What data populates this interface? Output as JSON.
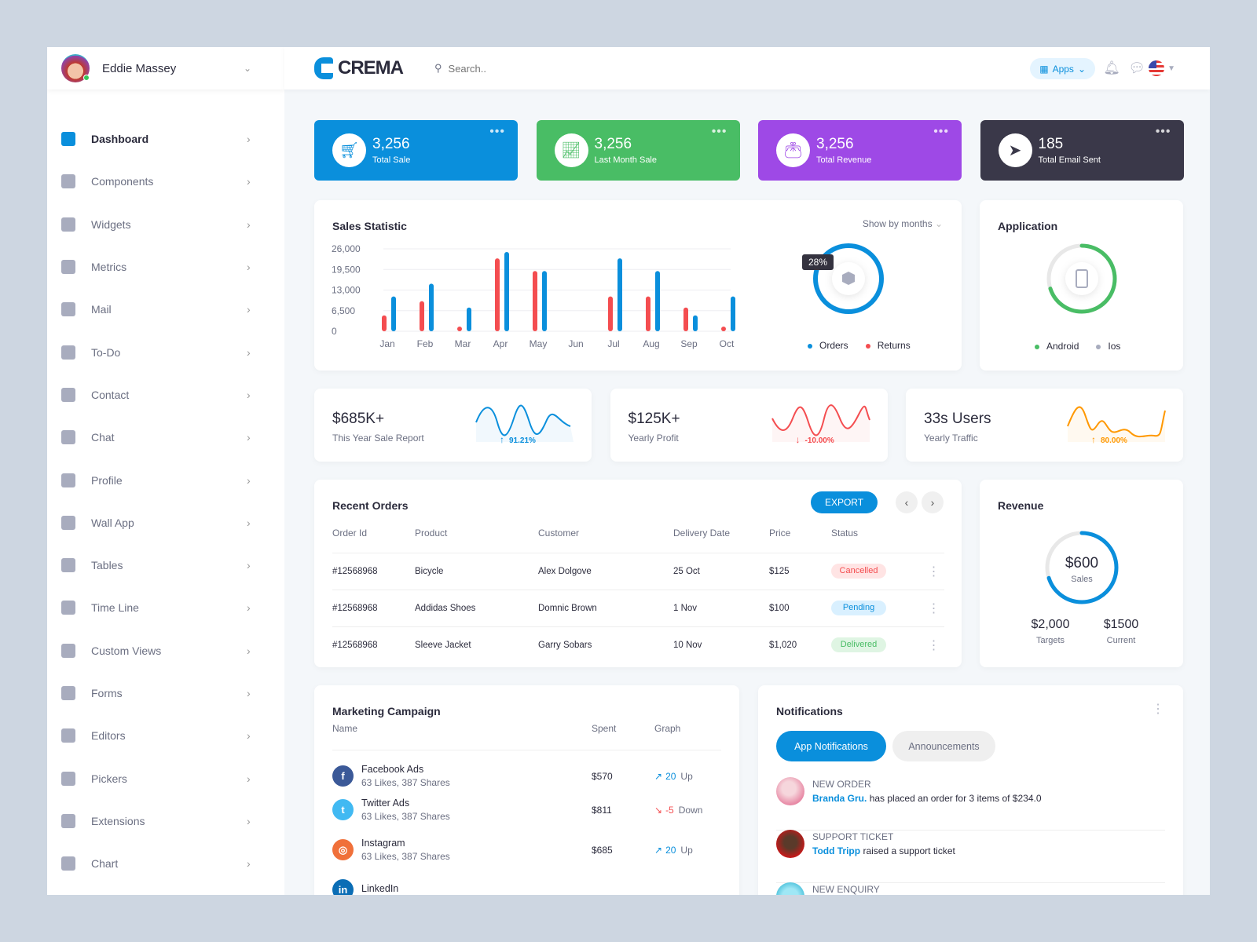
{
  "user": {
    "name": "Eddie Massey"
  },
  "brand": {
    "name": "CREMA"
  },
  "search": {
    "placeholder": "Search.."
  },
  "topbar": {
    "apps_label": "Apps"
  },
  "sidebar": {
    "items": [
      {
        "label": "Dashboard",
        "active": true
      },
      {
        "label": "Components"
      },
      {
        "label": "Widgets"
      },
      {
        "label": "Metrics"
      },
      {
        "label": "Mail"
      },
      {
        "label": "To-Do"
      },
      {
        "label": "Contact"
      },
      {
        "label": "Chat"
      },
      {
        "label": "Profile"
      },
      {
        "label": "Wall App"
      },
      {
        "label": "Tables"
      },
      {
        "label": "Time Line"
      },
      {
        "label": "Custom Views"
      },
      {
        "label": "Forms"
      },
      {
        "label": "Editors"
      },
      {
        "label": "Pickers"
      },
      {
        "label": "Extensions"
      },
      {
        "label": "Chart"
      }
    ]
  },
  "kpis": [
    {
      "value": "3,256",
      "label": "Total Sale",
      "color": "#0a8fdc",
      "icon": "cart-icon"
    },
    {
      "value": "3,256",
      "label": "Last Month Sale",
      "color": "#49bd65",
      "icon": "growth-chart-icon"
    },
    {
      "value": "3,256",
      "label": "Total Revenue",
      "color": "#9e49e6",
      "icon": "wallet-icon"
    },
    {
      "value": "185",
      "label": "Total Email Sent",
      "color": "#3a3849",
      "icon": "paper-plane-icon"
    }
  ],
  "sales": {
    "title": "Sales Statistic",
    "filter": "Show by months",
    "tooltip": "28%",
    "legend": [
      "Orders",
      "Returns"
    ]
  },
  "chart_data": {
    "type": "bar",
    "title": "Sales Statistic",
    "categories": [
      "Jan",
      "Feb",
      "Mar",
      "Apr",
      "May",
      "Jun",
      "Jul",
      "Aug",
      "Sep",
      "Oct"
    ],
    "yticks": [
      "26,000",
      "19,500",
      "13,000",
      "6,500",
      "0"
    ],
    "ylim": [
      0,
      26000
    ],
    "grid": true,
    "series": [
      {
        "name": "Returns",
        "color": "#f44d50",
        "values": [
          5000,
          9500,
          1500,
          23000,
          19000,
          null,
          11000,
          11000,
          7500,
          1500
        ]
      },
      {
        "name": "Orders",
        "color": "#0a8fdc",
        "values": [
          11000,
          15000,
          7500,
          25000,
          19000,
          null,
          23000,
          19000,
          5000,
          11000
        ]
      }
    ],
    "donut": {
      "Orders": 72,
      "Returns": 28
    }
  },
  "application": {
    "title": "Application",
    "android_percent": 70,
    "legend": [
      "Android",
      "Ios"
    ]
  },
  "stats": [
    {
      "value": "$685K+",
      "label": "This Year Sale Report",
      "change": "91.21%",
      "color": "#0a8fdc",
      "trend": "up"
    },
    {
      "value": "$125K+",
      "label": "Yearly Profit",
      "change": "-10.00%",
      "color": "#f44d50",
      "trend": "down"
    },
    {
      "value": "33s Users",
      "label": "Yearly Traffic",
      "change": "80.00%",
      "color": "#ff9800",
      "trend": "up"
    }
  ],
  "orders": {
    "title": "Recent Orders",
    "export": "EXPORT",
    "columns": [
      "Order Id",
      "Product",
      "Customer",
      "Delivery Date",
      "Price",
      "Status"
    ],
    "rows": [
      [
        "#12568968",
        "Bicycle",
        "Alex Dolgove",
        "25 Oct",
        "$125",
        "Cancelled"
      ],
      [
        "#12568968",
        "Addidas Shoes",
        "Domnic Brown",
        "1 Nov",
        "$100",
        "Pending"
      ],
      [
        "#12568968",
        "Sleeve Jacket",
        "Garry Sobars",
        "10 Nov",
        "$1,020",
        "Delivered"
      ]
    ]
  },
  "revenue": {
    "title": "Revenue",
    "value": "$600",
    "value_label": "Sales",
    "progress_percent": 70,
    "targets": "$2,000",
    "targets_label": "Targets",
    "current": "$1500",
    "current_label": "Current"
  },
  "marketing": {
    "title": "Marketing Campaign",
    "columns": [
      "Name",
      "Spent",
      "Graph"
    ],
    "rows": [
      {
        "name": "Facebook Ads",
        "meta": "63 Likes, 387 Shares",
        "spent": "$570",
        "delta": "20",
        "dir": "Up",
        "color": "#3b5998",
        "icon": "facebook-icon",
        "glyph": "f"
      },
      {
        "name": "Twitter Ads",
        "meta": "63 Likes, 387 Shares",
        "spent": "$811",
        "delta": "-5",
        "dir": "Down",
        "color": "#41b9f2",
        "icon": "twitter-icon",
        "glyph": "t"
      },
      {
        "name": "Instagram",
        "meta": "63 Likes, 387 Shares",
        "spent": "$685",
        "delta": "20",
        "dir": "Up",
        "color": "#f0703a",
        "icon": "instagram-icon",
        "glyph": "◎"
      },
      {
        "name": "LinkedIn",
        "meta": "",
        "spent": "",
        "delta": "",
        "dir": "",
        "color": "#0a6db5",
        "icon": "linkedin-icon",
        "glyph": "in"
      }
    ]
  },
  "notifications": {
    "title": "Notifications",
    "tabs": [
      "App Notifications",
      "Announcements"
    ],
    "items": [
      {
        "type": "NEW ORDER",
        "who": "Branda Gru.",
        "text": " has placed an order for 3 items of $234.0"
      },
      {
        "type": "SUPPORT TICKET",
        "who": "Todd Tripp",
        "text": " raised a support ticket"
      },
      {
        "type": "NEW ENQUIRY",
        "who": "",
        "text": ""
      }
    ]
  }
}
